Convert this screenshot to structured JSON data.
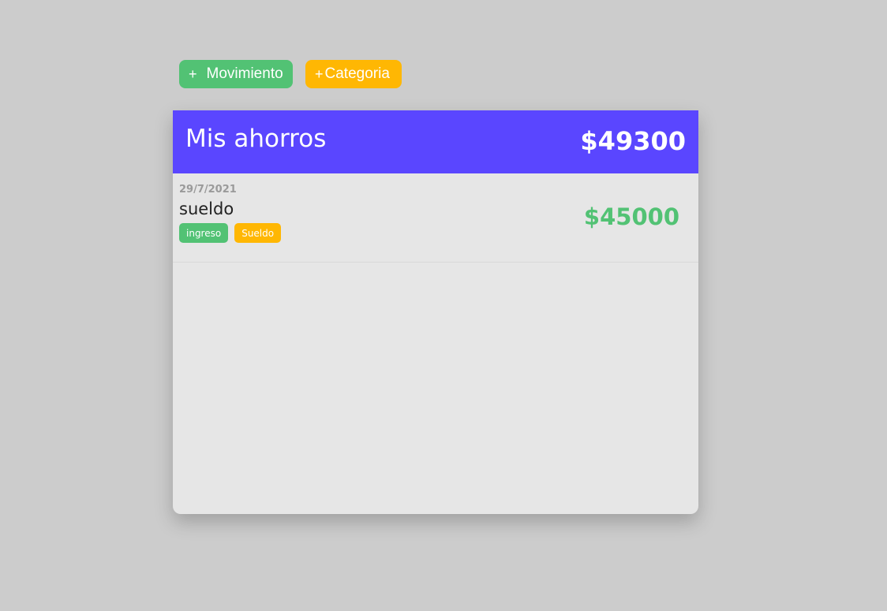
{
  "toolbar": {
    "add_movement": {
      "icon": "plus-icon",
      "plus": "+",
      "label": "Movimiento"
    },
    "add_category": {
      "icon": "plus-icon",
      "plus": "+",
      "label": "Categoria"
    }
  },
  "savings": {
    "title": "Mis ahorros",
    "total": "$49300"
  },
  "movements": [
    {
      "date": "29/7/2021",
      "name": "sueldo",
      "tags": [
        "ingreso",
        "Sueldo"
      ],
      "amount": "$45000"
    }
  ],
  "colors": {
    "background": "#cccccc",
    "header": "#5a46ff",
    "green": "#52c274",
    "yellow": "#ffb703",
    "card": "#e6e6e6"
  }
}
